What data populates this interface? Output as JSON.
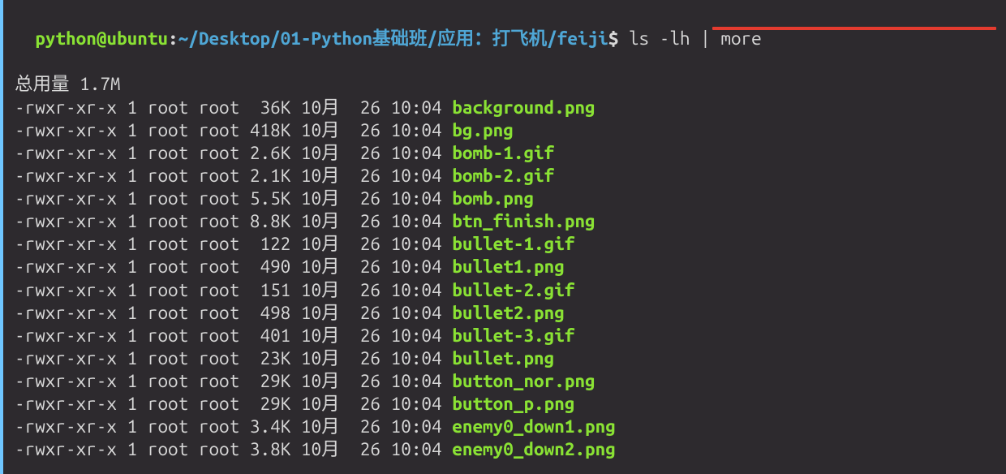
{
  "prompt": {
    "user": "python",
    "at": "@",
    "host": "ubuntu",
    "colon": ":",
    "path": "~/Desktop/01-Python基础班/应用：打飞机/feiji",
    "dollar": "$",
    "command": " ls -lh | more"
  },
  "total": {
    "label": "总用量 1.7M"
  },
  "rows": [
    {
      "perm": "-rwxr-xr-x",
      "links": "1",
      "owner": "root",
      "group": "root",
      "size": " 36K",
      "month": "10月",
      "day": " 26",
      "time": "10:04",
      "name": "background.png"
    },
    {
      "perm": "-rwxr-xr-x",
      "links": "1",
      "owner": "root",
      "group": "root",
      "size": "418K",
      "month": "10月",
      "day": " 26",
      "time": "10:04",
      "name": "bg.png"
    },
    {
      "perm": "-rwxr-xr-x",
      "links": "1",
      "owner": "root",
      "group": "root",
      "size": "2.6K",
      "month": "10月",
      "day": " 26",
      "time": "10:04",
      "name": "bomb-1.gif"
    },
    {
      "perm": "-rwxr-xr-x",
      "links": "1",
      "owner": "root",
      "group": "root",
      "size": "2.1K",
      "month": "10月",
      "day": " 26",
      "time": "10:04",
      "name": "bomb-2.gif"
    },
    {
      "perm": "-rwxr-xr-x",
      "links": "1",
      "owner": "root",
      "group": "root",
      "size": "5.5K",
      "month": "10月",
      "day": " 26",
      "time": "10:04",
      "name": "bomb.png"
    },
    {
      "perm": "-rwxr-xr-x",
      "links": "1",
      "owner": "root",
      "group": "root",
      "size": "8.8K",
      "month": "10月",
      "day": " 26",
      "time": "10:04",
      "name": "btn_finish.png"
    },
    {
      "perm": "-rwxr-xr-x",
      "links": "1",
      "owner": "root",
      "group": "root",
      "size": " 122",
      "month": "10月",
      "day": " 26",
      "time": "10:04",
      "name": "bullet-1.gif"
    },
    {
      "perm": "-rwxr-xr-x",
      "links": "1",
      "owner": "root",
      "group": "root",
      "size": " 490",
      "month": "10月",
      "day": " 26",
      "time": "10:04",
      "name": "bullet1.png"
    },
    {
      "perm": "-rwxr-xr-x",
      "links": "1",
      "owner": "root",
      "group": "root",
      "size": " 151",
      "month": "10月",
      "day": " 26",
      "time": "10:04",
      "name": "bullet-2.gif"
    },
    {
      "perm": "-rwxr-xr-x",
      "links": "1",
      "owner": "root",
      "group": "root",
      "size": " 498",
      "month": "10月",
      "day": " 26",
      "time": "10:04",
      "name": "bullet2.png"
    },
    {
      "perm": "-rwxr-xr-x",
      "links": "1",
      "owner": "root",
      "group": "root",
      "size": " 401",
      "month": "10月",
      "day": " 26",
      "time": "10:04",
      "name": "bullet-3.gif"
    },
    {
      "perm": "-rwxr-xr-x",
      "links": "1",
      "owner": "root",
      "group": "root",
      "size": " 23K",
      "month": "10月",
      "day": " 26",
      "time": "10:04",
      "name": "bullet.png"
    },
    {
      "perm": "-rwxr-xr-x",
      "links": "1",
      "owner": "root",
      "group": "root",
      "size": " 29K",
      "month": "10月",
      "day": " 26",
      "time": "10:04",
      "name": "button_nor.png"
    },
    {
      "perm": "-rwxr-xr-x",
      "links": "1",
      "owner": "root",
      "group": "root",
      "size": " 29K",
      "month": "10月",
      "day": " 26",
      "time": "10:04",
      "name": "button_p.png"
    },
    {
      "perm": "-rwxr-xr-x",
      "links": "1",
      "owner": "root",
      "group": "root",
      "size": "3.4K",
      "month": "10月",
      "day": " 26",
      "time": "10:04",
      "name": "enemy0_down1.png"
    },
    {
      "perm": "-rwxr-xr-x",
      "links": "1",
      "owner": "root",
      "group": "root",
      "size": "3.8K",
      "month": "10月",
      "day": " 26",
      "time": "10:04",
      "name": "enemy0_down2.png"
    }
  ]
}
